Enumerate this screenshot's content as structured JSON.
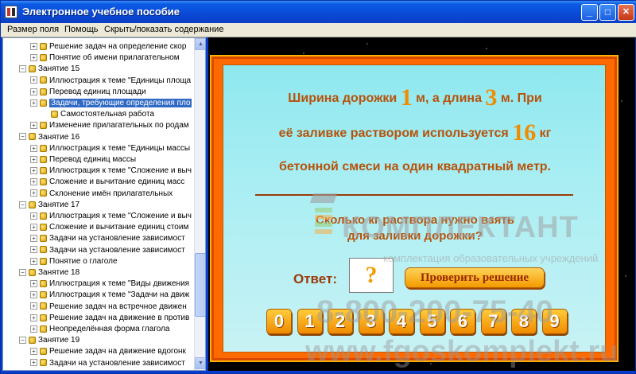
{
  "window": {
    "title": "Электронное учебное пособие",
    "controls": {
      "minimize": "_",
      "maximize": "□",
      "close": "✕"
    }
  },
  "menu": {
    "items": [
      "Размер поля",
      "Помощь",
      "Скрыть/показать содержание"
    ]
  },
  "tree": {
    "nodes": [
      {
        "level": 2,
        "label": "Решение задач на определение скор"
      },
      {
        "level": 2,
        "label": "Понятие об имени прилагательном"
      },
      {
        "level": 1,
        "label": "Занятие 15",
        "expanded": true
      },
      {
        "level": 2,
        "label": "Иллюстрация к теме \"Единицы площа"
      },
      {
        "level": 2,
        "label": "Перевод единиц площади"
      },
      {
        "level": 2,
        "label": "Задачи, требующие определения пло",
        "selected": true
      },
      {
        "level": 3,
        "label": "Самостоятельная работа"
      },
      {
        "level": 2,
        "label": "Изменение прилагательных по родам"
      },
      {
        "level": 1,
        "label": "Занятие 16",
        "expanded": true
      },
      {
        "level": 2,
        "label": "Иллюстрация к теме \"Единицы массы"
      },
      {
        "level": 2,
        "label": "Перевод единиц массы"
      },
      {
        "level": 2,
        "label": "Иллюстрация к теме \"Сложение и выч"
      },
      {
        "level": 2,
        "label": "Сложение и вычитание единиц масс"
      },
      {
        "level": 2,
        "label": "Склонение имён прилагательных"
      },
      {
        "level": 1,
        "label": "Занятие 17",
        "expanded": true
      },
      {
        "level": 2,
        "label": "Иллюстрация к теме \"Сложение и выч"
      },
      {
        "level": 2,
        "label": "Сложение и вычитание единиц стоим"
      },
      {
        "level": 2,
        "label": "Задачи на установление зависимост"
      },
      {
        "level": 2,
        "label": "Задачи на установление зависимост"
      },
      {
        "level": 2,
        "label": "Понятие о глаголе"
      },
      {
        "level": 1,
        "label": "Занятие 18",
        "expanded": true
      },
      {
        "level": 2,
        "label": "Иллюстрация к теме \"Виды движения"
      },
      {
        "level": 2,
        "label": "Иллюстрация к теме \"Задачи на движ"
      },
      {
        "level": 2,
        "label": "Решение задач на встречное движен"
      },
      {
        "level": 2,
        "label": "Решение задач на движение в против"
      },
      {
        "level": 2,
        "label": "Неопределённая форма глагола"
      },
      {
        "level": 1,
        "label": "Занятие 19",
        "expanded": true
      },
      {
        "level": 2,
        "label": "Решение задач на движение вдогонк"
      },
      {
        "level": 2,
        "label": "Задачи на установление зависимост"
      }
    ]
  },
  "task": {
    "line1_a": "Ширина дорожки",
    "width_value": "1",
    "line1_b": "м, а длина",
    "length_value": "3",
    "line1_c": "м. При",
    "line2_a": "её заливке раствором используется",
    "mass_value": "16",
    "line2_b": "кг",
    "line3": "бетонной смеси на один квадратный метр.",
    "question_line1": "Сколько кг раствора нужно взять",
    "question_line2": "для заливки дорожки?",
    "answer_label": "Ответ:",
    "answer_value": "?",
    "check_button": "Проверить решение",
    "digits": [
      "0",
      "1",
      "2",
      "3",
      "4",
      "5",
      "6",
      "7",
      "8",
      "9"
    ]
  },
  "watermark": {
    "brand": "КОМПЛЕКТАНТ",
    "tagline": "комплектация образовательных учреждений",
    "phone": "8-800-200-75-40",
    "site": "www.fgoskomplekt.ru"
  }
}
